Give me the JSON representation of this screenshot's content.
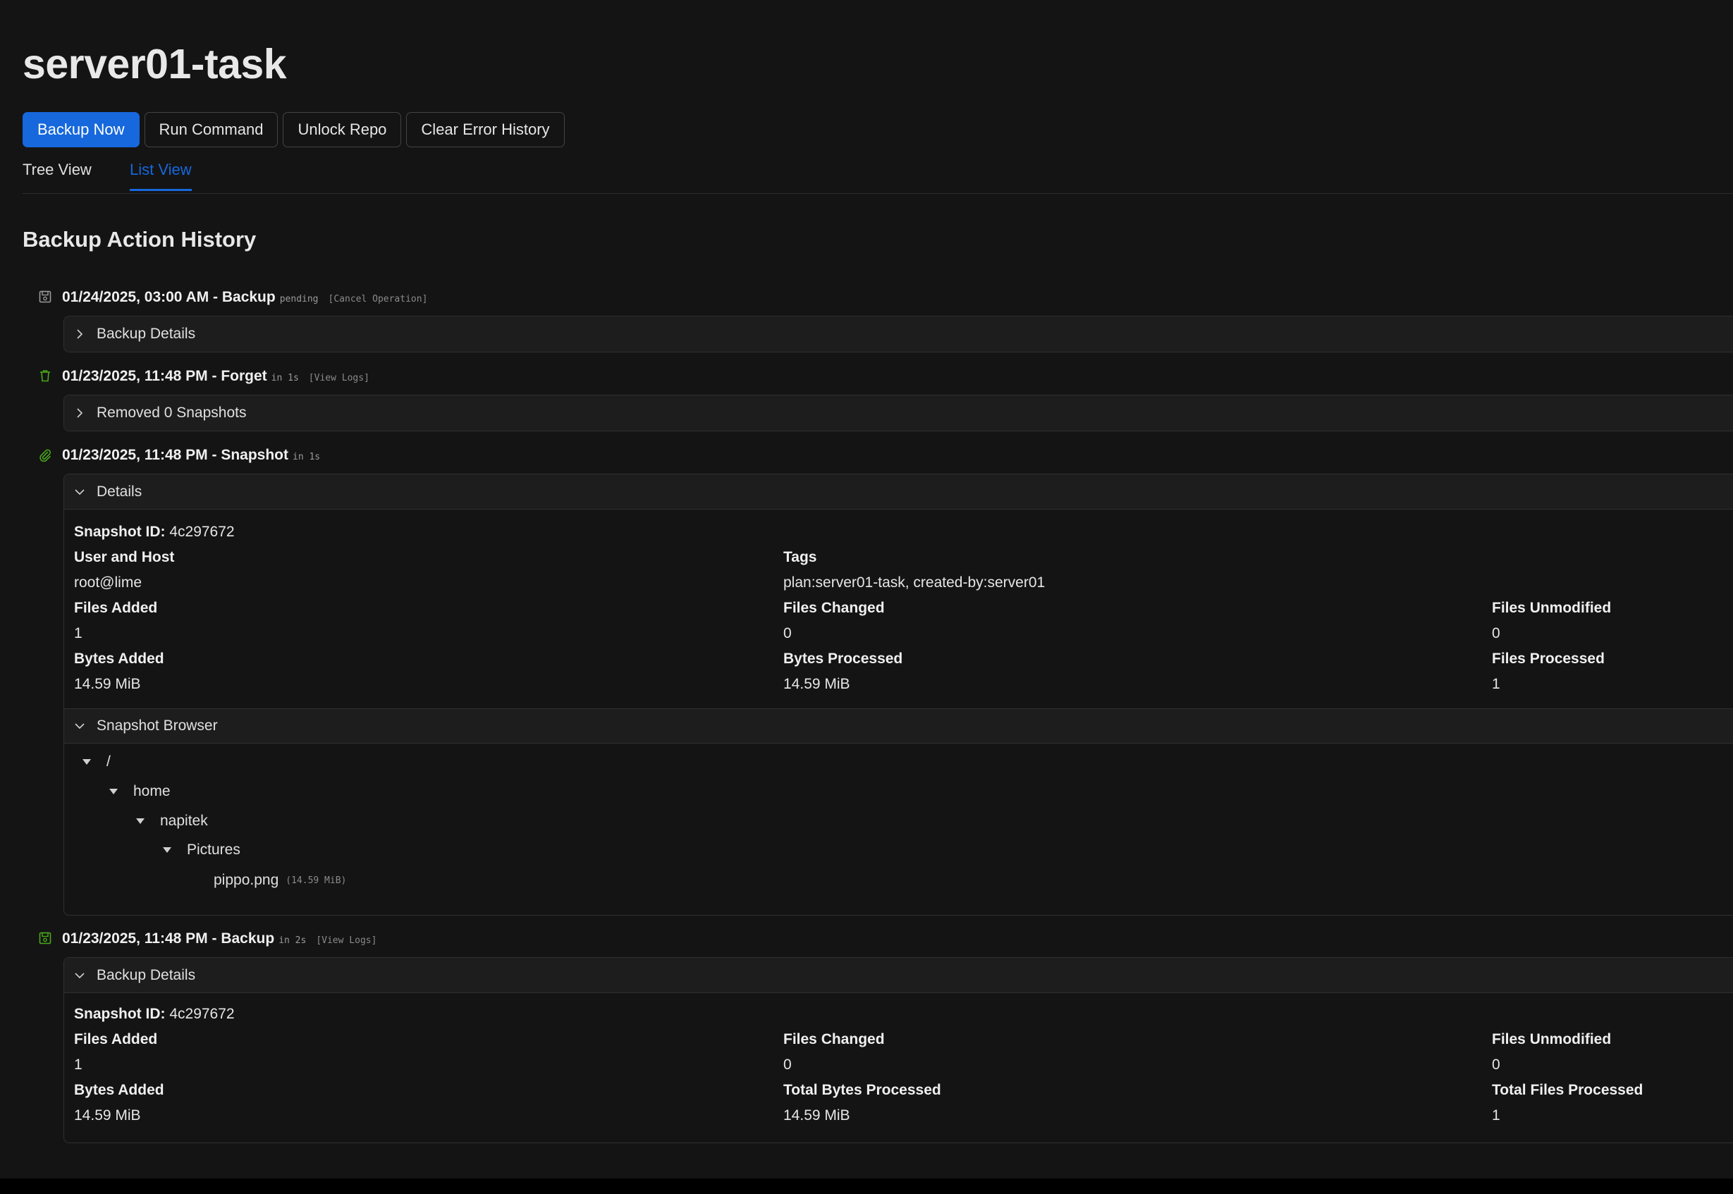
{
  "page": {
    "title": "server01-task"
  },
  "toolbar": {
    "backup_now": "Backup Now",
    "run_command": "Run Command",
    "unlock_repo": "Unlock Repo",
    "clear_error_history": "Clear Error History"
  },
  "tabs": {
    "tree_view": "Tree View",
    "list_view": "List View",
    "active": "List View"
  },
  "history": {
    "title": "Backup Action History",
    "entries": [
      {
        "title": "01/24/2025, 03:00 AM - Backup",
        "status": "pending",
        "link": "[Cancel Operation]",
        "icon": "backup-icon",
        "icon_color": "#9a9a9a",
        "panel_label": "Backup Details"
      },
      {
        "title": "01/23/2025, 11:48 PM - Forget",
        "status": "in 1s",
        "link": "[View Logs]",
        "icon": "trash-icon",
        "icon_color": "#49aa19",
        "panel_label": "Removed 0 Snapshots"
      },
      {
        "title": "01/23/2025, 11:48 PM - Snapshot",
        "status": "in 1s",
        "icon": "paperclip-icon",
        "icon_color": "#49aa19",
        "panel_label": "Details",
        "snapshot_id_label": "Snapshot ID:",
        "snapshot_id": "4c297672",
        "user_host_label": "User and Host",
        "user_host": "root@lime",
        "tags_label": "Tags",
        "tags": "plan:server01-task, created-by:server01",
        "files_added_label": "Files Added",
        "files_added": "1",
        "files_changed_label": "Files Changed",
        "files_changed": "0",
        "files_unmodified_label": "Files Unmodified",
        "files_unmodified": "0",
        "bytes_added_label": "Bytes Added",
        "bytes_added": "14.59 MiB",
        "bytes_processed_label": "Bytes Processed",
        "bytes_processed": "14.59 MiB",
        "files_processed_label": "Files Processed",
        "files_processed": "1",
        "browser_label": "Snapshot Browser",
        "tree": {
          "root": "/",
          "home": "home",
          "user": "napitek",
          "folder": "Pictures",
          "file": "pippo.png",
          "file_size": "(14.59 MiB)"
        }
      },
      {
        "title": "01/23/2025, 11:48 PM - Backup",
        "status": "in 2s",
        "link": "[View Logs]",
        "icon": "backup-icon",
        "icon_color": "#49aa19",
        "panel_label": "Backup Details",
        "snapshot_id_label": "Snapshot ID:",
        "snapshot_id": "4c297672",
        "files_added_label": "Files Added",
        "files_added": "1",
        "files_changed_label": "Files Changed",
        "files_changed": "0",
        "files_unmodified_label": "Files Unmodified",
        "files_unmodified": "0",
        "bytes_added_label": "Bytes Added",
        "bytes_added": "14.59 MiB",
        "total_bytes_processed_label": "Total Bytes Processed",
        "total_bytes_processed": "14.59 MiB",
        "total_files_processed_label": "Total Files Processed",
        "total_files_processed": "1"
      }
    ]
  },
  "colors": {
    "accent": "#1668dc",
    "success": "#49aa19",
    "background": "#141414"
  }
}
